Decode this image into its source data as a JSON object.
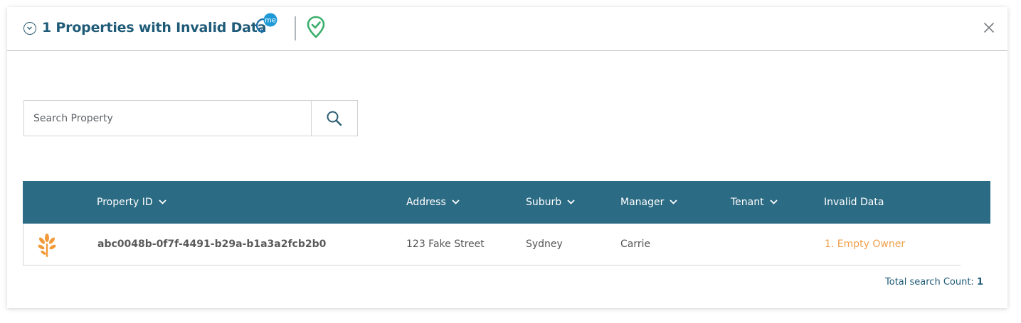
{
  "header": {
    "title": "1 Properties with Invalid Data",
    "collapse_icon": "chevron-circle-icon",
    "me_badge": "me",
    "verified_icon": "location-check-icon",
    "close_icon": "close-icon"
  },
  "search": {
    "placeholder": "Search Property",
    "value": "",
    "button_icon": "search-icon"
  },
  "table": {
    "columns": [
      {
        "label": "Property ID",
        "sortable": true
      },
      {
        "label": "Address",
        "sortable": true
      },
      {
        "label": "Suburb",
        "sortable": true
      },
      {
        "label": "Manager",
        "sortable": true
      },
      {
        "label": "Tenant",
        "sortable": true
      },
      {
        "label": "Invalid Data",
        "sortable": false
      }
    ],
    "rows": [
      {
        "icon": "tree-icon",
        "property_id": "abc0048b-0f7f-4491-b29a-b1a3a2fcb2b0",
        "address": "123 Fake Street",
        "suburb": "Sydney",
        "manager": "Carrie",
        "tenant": "",
        "invalid_data": "1. Empty Owner"
      }
    ]
  },
  "footer": {
    "total_label": "Total search Count:",
    "total_value": "1"
  },
  "colors": {
    "header_bg": "#2c6b84",
    "title": "#1f5b78",
    "invalid_text": "#f0a04b",
    "me_badge": "#1e9ad6",
    "verified": "#3aae6b"
  }
}
